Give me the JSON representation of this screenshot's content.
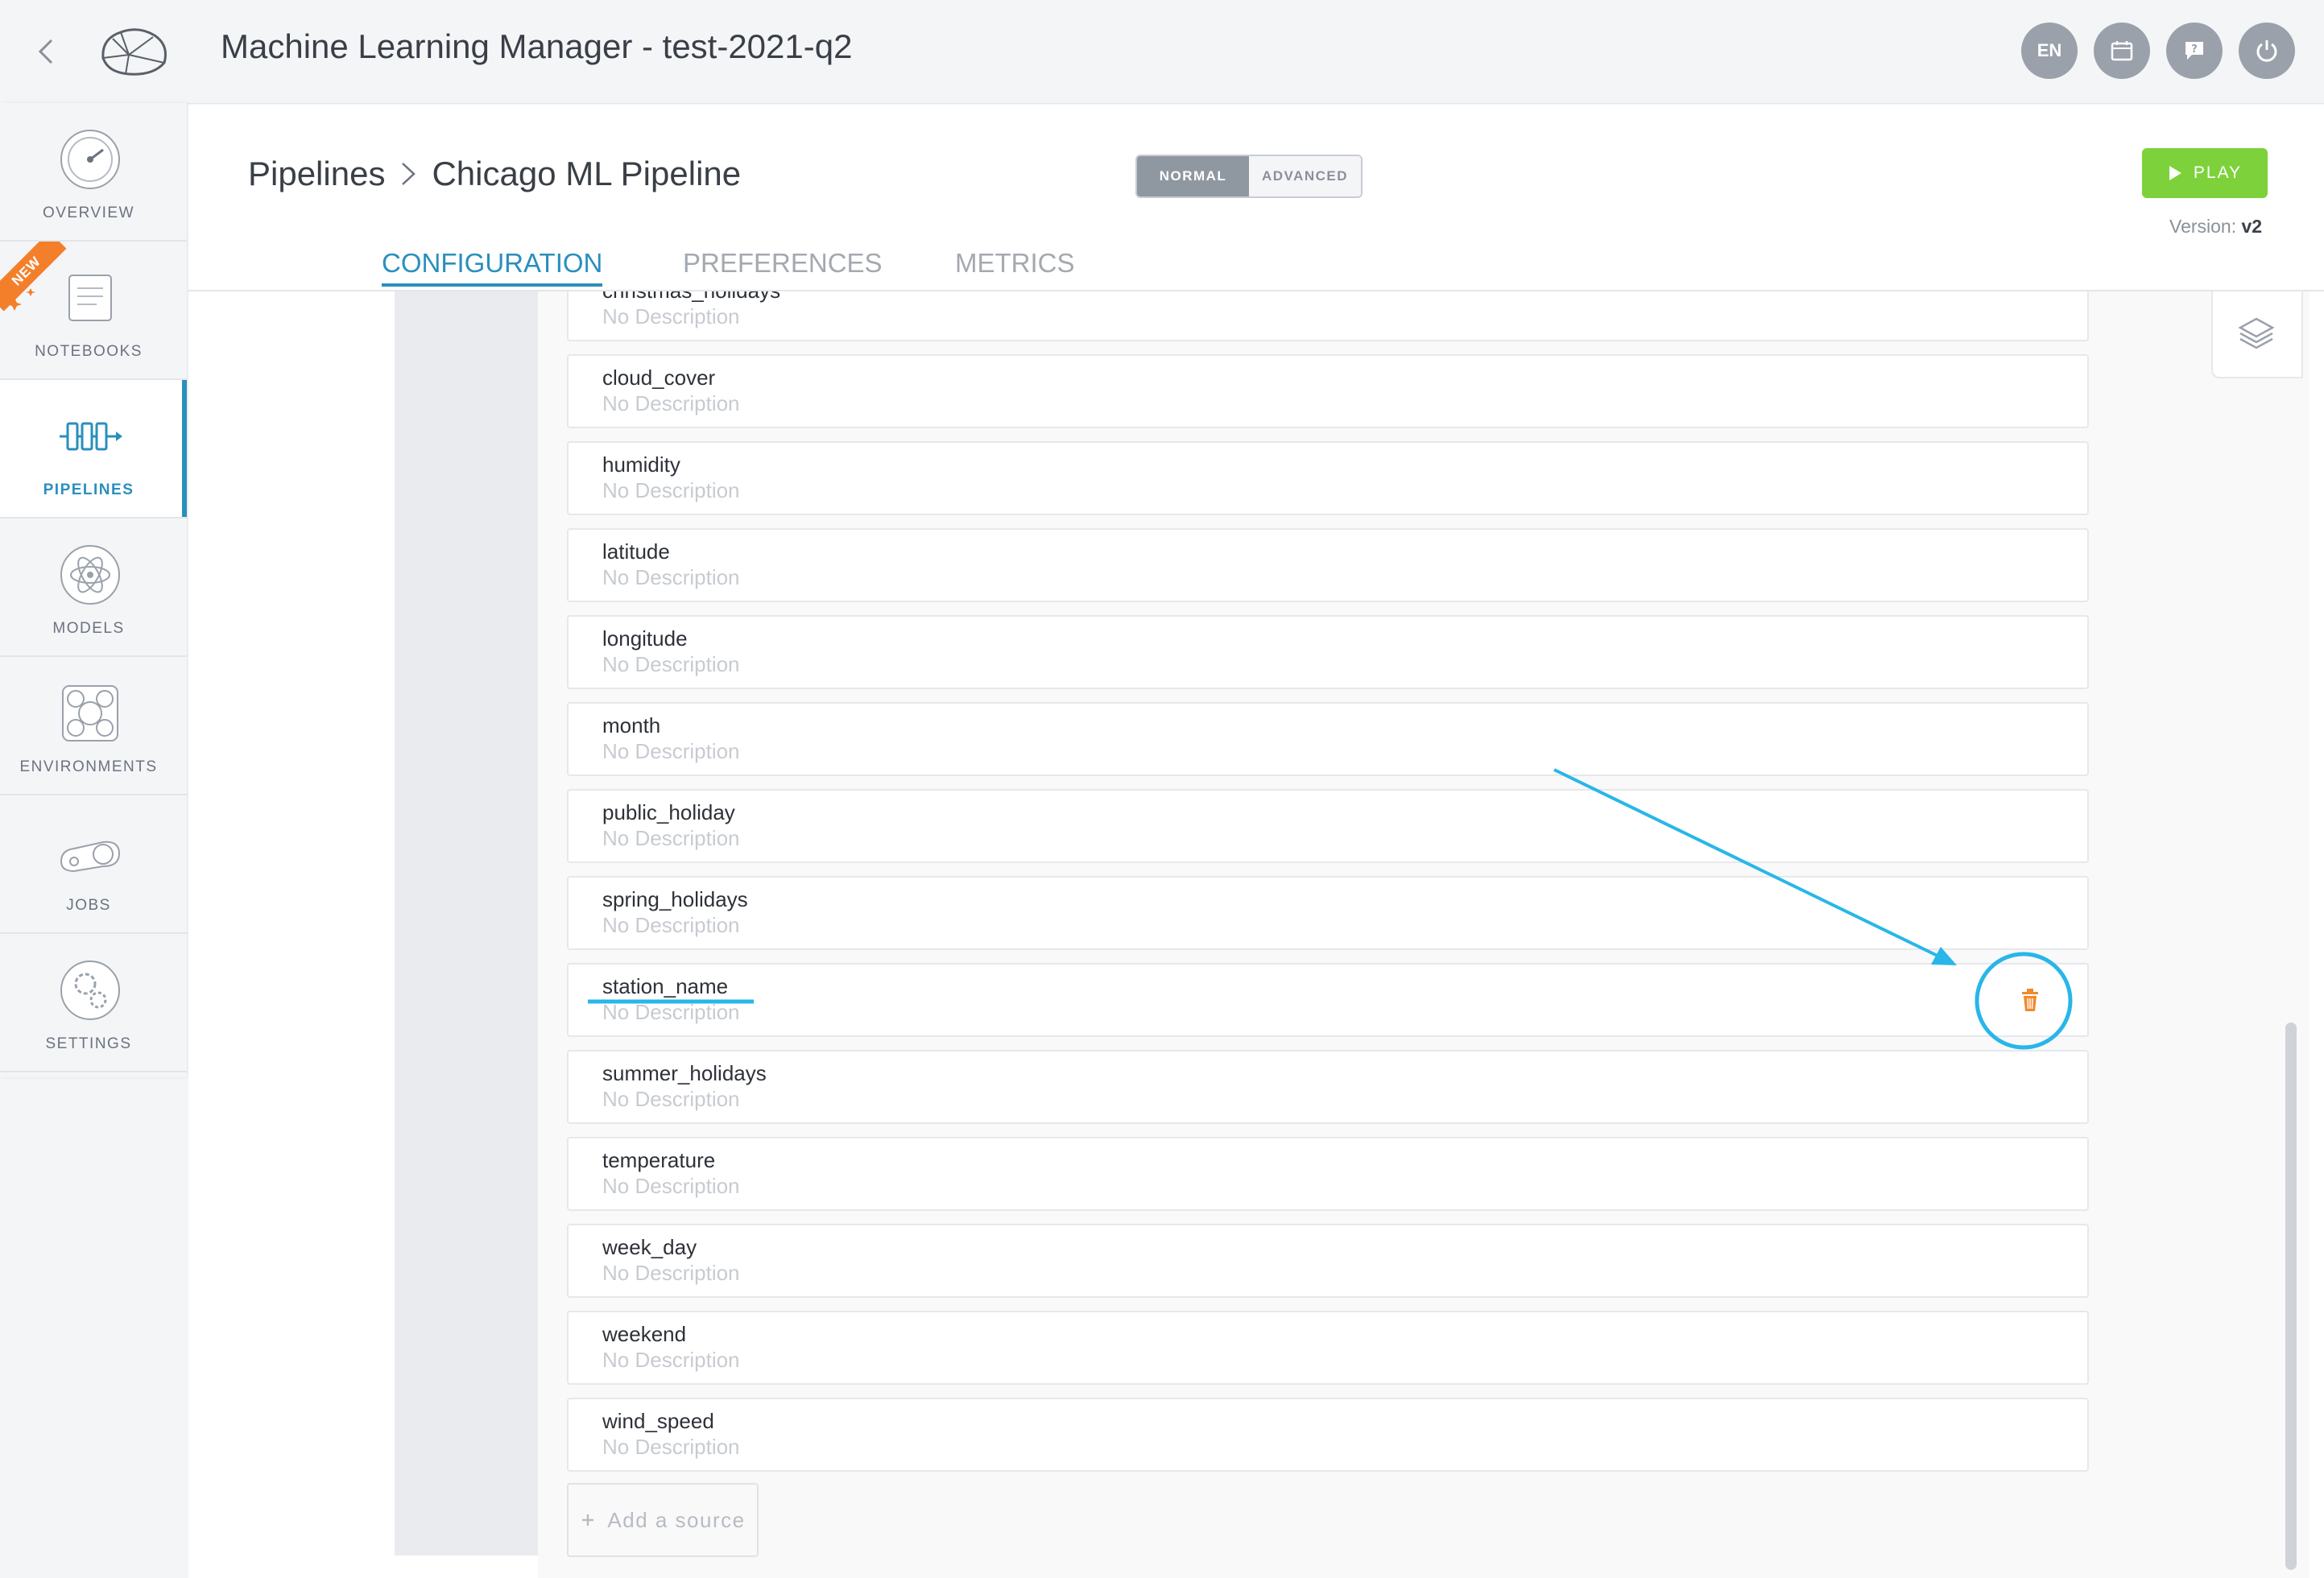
{
  "topbar": {
    "title": "Machine Learning Manager - test-2021-q2",
    "buttons": [
      {
        "label": "EN",
        "icon": "language-icon"
      },
      {
        "label": "",
        "icon": "calendar-icon"
      },
      {
        "label": "",
        "icon": "help-chat-icon"
      },
      {
        "label": "",
        "icon": "power-icon"
      }
    ]
  },
  "sidebar": {
    "items": [
      {
        "label": "OVERVIEW",
        "icon": "dashboard-gauge-icon",
        "active": false
      },
      {
        "label": "NOTEBOOKS",
        "icon": "notebook-icon",
        "active": false,
        "badge": "NEW"
      },
      {
        "label": "PIPELINES",
        "icon": "pipeline-icon",
        "active": true
      },
      {
        "label": "MODELS",
        "icon": "atom-icon",
        "active": false
      },
      {
        "label": "ENVIRONMENTS",
        "icon": "environment-icon",
        "active": false
      },
      {
        "label": "JOBS",
        "icon": "jobs-icon",
        "active": false
      },
      {
        "label": "SETTINGS",
        "icon": "gears-icon",
        "active": false
      }
    ]
  },
  "header": {
    "breadcrumb": [
      "Pipelines",
      "Chicago ML Pipeline"
    ],
    "mode": {
      "normal": "NORMAL",
      "advanced": "ADVANCED",
      "selected": "NORMAL"
    },
    "play_label": "PLAY",
    "version_label": "Version:",
    "version_value": "v2",
    "tabs": [
      {
        "label": "CONFIGURATION",
        "active": true
      },
      {
        "label": "PREFERENCES",
        "active": false
      },
      {
        "label": "METRICS",
        "active": false
      }
    ]
  },
  "sources": {
    "items": [
      {
        "name": "christmas_holidays",
        "description": "No Description"
      },
      {
        "name": "cloud_cover",
        "description": "No Description"
      },
      {
        "name": "humidity",
        "description": "No Description"
      },
      {
        "name": "latitude",
        "description": "No Description"
      },
      {
        "name": "longitude",
        "description": "No Description"
      },
      {
        "name": "month",
        "description": "No Description"
      },
      {
        "name": "public_holiday",
        "description": "No Description"
      },
      {
        "name": "spring_holidays",
        "description": "No Description"
      },
      {
        "name": "station_name",
        "description": "No Description"
      },
      {
        "name": "summer_holidays",
        "description": "No Description"
      },
      {
        "name": "temperature",
        "description": "No Description"
      },
      {
        "name": "week_day",
        "description": "No Description"
      },
      {
        "name": "weekend",
        "description": "No Description"
      },
      {
        "name": "wind_speed",
        "description": "No Description"
      }
    ],
    "add_label": "Add a source"
  },
  "colors": {
    "accent": "#2a8fbd",
    "play": "#7dd23b",
    "delete": "#f08a2c",
    "annotation": "#29b6e8",
    "new_badge": "#f47f2b"
  }
}
